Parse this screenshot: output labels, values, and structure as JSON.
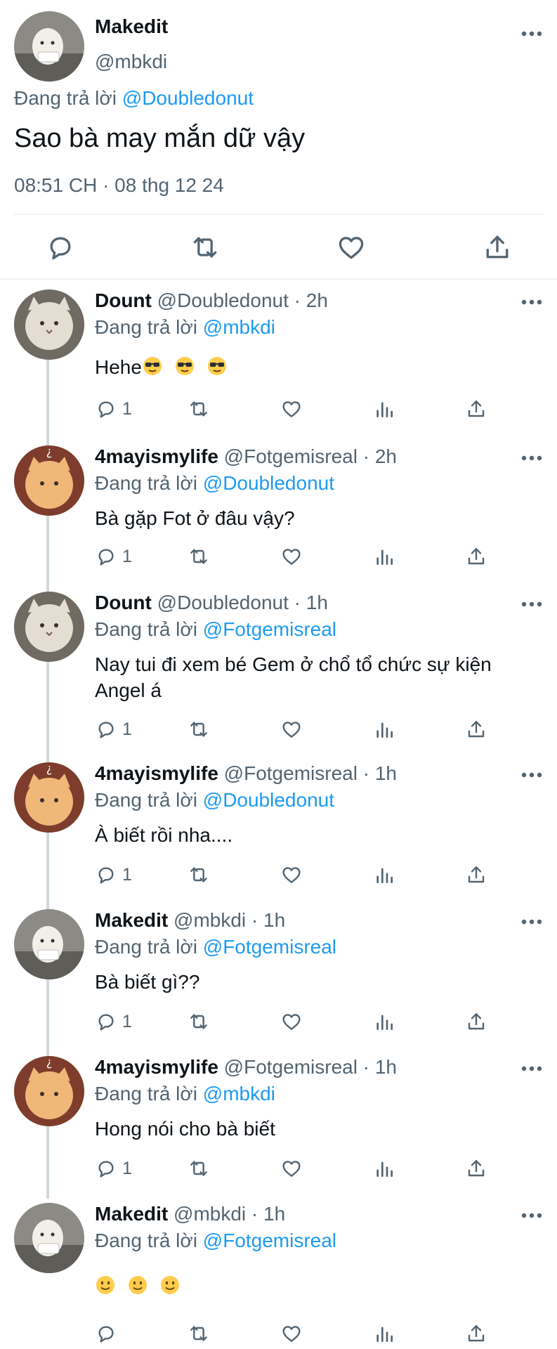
{
  "main_tweet": {
    "name": "Makedit",
    "handle": "@mbkdi",
    "reply_prefix": "Đang trả lời",
    "reply_to": "@Doubledonut",
    "text": "Sao bà may mắn dữ vậy",
    "timestamp": "08:51 CH · 08 thg 12 24"
  },
  "replies": [
    {
      "name": "Dount",
      "meta": "@Doubledonut · 2h",
      "reply_prefix": "Đang trả lời",
      "reply_to": "@mbkdi",
      "text": "Hehe",
      "emoji": "sunglasses",
      "emoji_count": 3,
      "reply_count": "1",
      "avatar": "cat-grey"
    },
    {
      "name": "4mayismylife",
      "meta": "@Fotgemisreal · 2h",
      "reply_prefix": "Đang trả lời",
      "reply_to": "@Doubledonut",
      "text": "Bà gặp Fot ở đâu vậy?",
      "reply_count": "1",
      "avatar": "cat-orange"
    },
    {
      "name": "Dount",
      "meta": "@Doubledonut · 1h",
      "reply_prefix": "Đang trả lời",
      "reply_to": "@Fotgemisreal",
      "text": "Nay tui đi xem bé Gem ở chổ tổ chức sự kiện Angel á",
      "reply_count": "1",
      "avatar": "cat-grey"
    },
    {
      "name": "4mayismylife",
      "meta": "@Fotgemisreal · 1h",
      "reply_prefix": "Đang trả lời",
      "reply_to": "@Doubledonut",
      "text": "À biết rồi nha....",
      "reply_count": "1",
      "avatar": "cat-orange"
    },
    {
      "name": "Makedit",
      "meta": "@mbkdi · 1h",
      "reply_prefix": "Đang trả lời",
      "reply_to": "@Fotgemisreal",
      "text": "Bà biết gì??",
      "reply_count": "1",
      "avatar": "cat-white"
    },
    {
      "name": "4mayismylife",
      "meta": "@Fotgemisreal · 1h",
      "reply_prefix": "Đang trả lời",
      "reply_to": "@mbkdi",
      "text": "Hong nói cho bà biết",
      "reply_count": "1",
      "avatar": "cat-orange"
    },
    {
      "name": "Makedit",
      "meta": "@mbkdi · 1h",
      "reply_prefix": "Đang trả lời",
      "reply_to": "@Fotgemisreal",
      "text": "",
      "emoji": "slight-smile",
      "emoji_count": 3,
      "reply_count": "",
      "avatar": "cat-white"
    }
  ],
  "icons": {
    "reply": "reply-icon",
    "retweet": "retweet-icon",
    "like": "heart-icon",
    "views": "views-icon",
    "share": "share-icon",
    "more": "more-icon"
  },
  "colors": {
    "link": "#1d9bf0",
    "secondary_text": "#536471",
    "icon": "#536471",
    "thread_line": "#cfd9de"
  }
}
